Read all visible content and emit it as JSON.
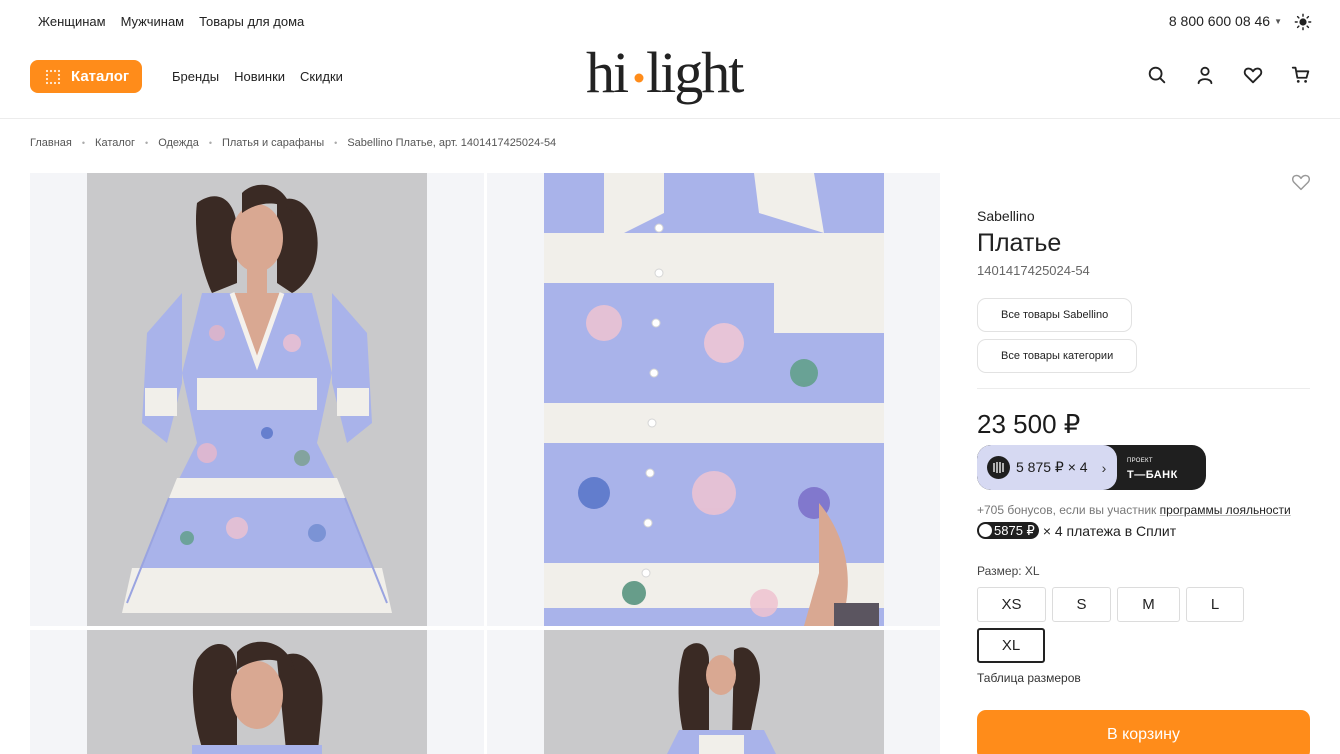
{
  "topbar": {
    "links": [
      "Женщинам",
      "Мужчинам",
      "Товары для дома"
    ],
    "phone": "8 800 600 08 46"
  },
  "header": {
    "catalog_label": "Каталог",
    "nav": [
      "Бренды",
      "Новинки",
      "Скидки"
    ],
    "logo_text": "hi·light",
    "accent_color": "#ff8c1a"
  },
  "breadcrumb": [
    "Главная",
    "Каталог",
    "Одежда",
    "Платья и сарафаны",
    "Sabellino Платье, арт. 1401417425024-54"
  ],
  "product": {
    "brand": "Sabellino",
    "title": "Платье",
    "article": "1401417425024-54",
    "all_brand_label": "Все товары Sabellino",
    "all_category_label": "Все товары категории",
    "price": "23 500 ₽",
    "installment": "5 875 ₽ × 4",
    "tbank_project": "ПРОЕКТ",
    "tbank_name": "Т—БАНК",
    "bonus_text": "+705 бонусов, если вы участник ",
    "bonus_link": "программы лояльности",
    "split_amount": "5875 ₽",
    "split_text": "× 4 платежа в Сплит",
    "size_label": "Размер: XL",
    "sizes": [
      "XS",
      "S",
      "M",
      "L",
      "XL"
    ],
    "selected_size": "XL",
    "size_table": "Таблица размеров",
    "cart_label": "В корзину"
  }
}
